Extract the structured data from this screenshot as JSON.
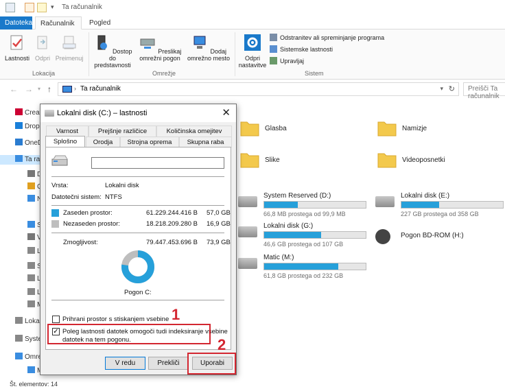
{
  "explorer": {
    "window_title": "Ta računalnik",
    "ribbon_tabs": [
      "Datoteka",
      "Računalnik",
      "Pogled"
    ],
    "ribbon": {
      "location_group": "Lokacija",
      "network_group": "Omrežje",
      "system_group": "Sistem",
      "btn_properties": "Lastnosti",
      "btn_open": "Odpri",
      "btn_rename": "Preimenuj",
      "btn_media": "Dostop do predstavnosti",
      "btn_map_drive": "Preslikaj omrežni pogon",
      "btn_add_location": "Dodaj omrežno mesto",
      "btn_settings": "Odpri nastavitve",
      "sys_uninstall": "Odstranitev ali spreminjanje programa",
      "sys_props": "Sistemske lastnosti",
      "sys_manage": "Upravljaj"
    },
    "address": {
      "crumb": "Ta računalnik",
      "search_placeholder": "Preišči Ta računalnik"
    },
    "nav_items": [
      {
        "label": "Creative Cloud Files"
      },
      {
        "label": "Dropbox"
      },
      {
        "label": "OneDrive"
      },
      {
        "label": "Ta računalnik"
      },
      {
        "label": "Dokumenti"
      },
      {
        "label": "Glasba"
      },
      {
        "label": "Namizje"
      },
      {
        "label": "Slike"
      },
      {
        "label": "Videoposnetki"
      },
      {
        "label": "Lokalni disk (C:)"
      },
      {
        "label": "System Reserved (D:)"
      },
      {
        "label": "Lokalni disk (E:)"
      },
      {
        "label": "Lokalni disk (G:)"
      },
      {
        "label": "Matic (M:)"
      },
      {
        "label": "Lokalni disk (C:)"
      },
      {
        "label": "System Reserved (D:)"
      },
      {
        "label": "Omrežje"
      },
      {
        "label": "MATIC-PC"
      }
    ],
    "folders": [
      {
        "label": "Glasba"
      },
      {
        "label": "Namizje"
      },
      {
        "label": "Slike"
      },
      {
        "label": "Videoposnetki"
      }
    ],
    "drives": [
      {
        "name": "System Reserved (D:)",
        "size": "66,8 MB prostega od 99,9 MB",
        "used_fraction": 0.33
      },
      {
        "name": "Lokalni disk (E:)",
        "size": "227 GB prostega od 358 GB",
        "used_fraction": 0.37
      },
      {
        "name": "Lokalni disk (G:)",
        "size": "46,6 GB prostega od 107 GB",
        "used_fraction": 0.56
      },
      {
        "name": "Pogon BD-ROM (H:)",
        "size": ""
      },
      {
        "name": "Matic (M:)",
        "size": "61,8 GB prostega od 232 GB",
        "used_fraction": 0.73
      }
    ],
    "status": "Št. elementov: 14"
  },
  "dialog": {
    "title": "Lokalni disk (C:) – lastnosti",
    "close_glyph": "✕",
    "tabs_top": [
      "Varnost",
      "Prejšnje različice",
      "Količinska omejitev"
    ],
    "tabs_bottom": [
      "Splošno",
      "Orodja",
      "Strojna oprema",
      "Skupna raba"
    ],
    "name_value": "",
    "type_label": "Vrsta:",
    "type_value": "Lokalni disk",
    "fs_label": "Datotečni sistem:",
    "fs_value": "NTFS",
    "used_label": "Zaseden prostor:",
    "used_bytes": "61.229.244.416 B",
    "used_gb": "57,0 GB",
    "free_label": "Nezaseden prostor:",
    "free_bytes": "18.218.209.280 B",
    "free_gb": "16,9 GB",
    "capacity_label": "Zmogljivost:",
    "capacity_bytes": "79.447.453.696 B",
    "capacity_gb": "73,9 GB",
    "used_fraction": 0.771,
    "drive_label": "Pogon C:",
    "compress_label": "Prihrani prostor s stiskanjem vsebine",
    "compress_checked": false,
    "index_label_1": "Poleg lastnosti datotek omogoči tudi indeksiranje vsebine",
    "index_label_2": "datotek na tem pogonu.",
    "index_checked": true,
    "btn_ok": "V redu",
    "btn_cancel": "Prekliči",
    "btn_apply": "Uporabi",
    "colors": {
      "used": "#26a0da",
      "free": "#bebebe"
    }
  },
  "annotations": {
    "num1": "1",
    "num2": "2",
    "color": "#d32630"
  }
}
